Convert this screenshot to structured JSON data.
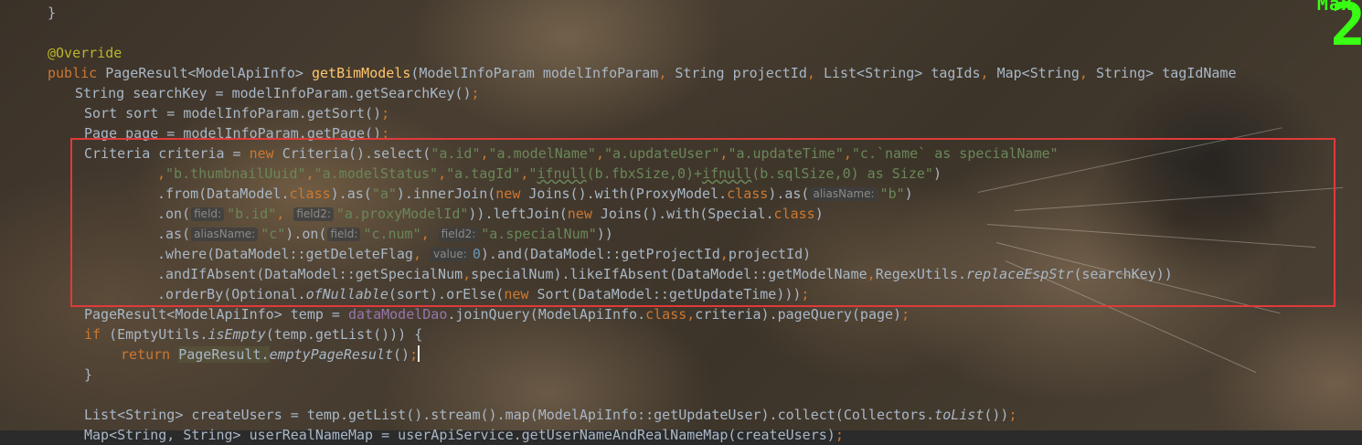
{
  "editor": {
    "theme_colors": {
      "keyword": "#cc7832",
      "annotation": "#bbb529",
      "method_declaration": "#ffc66d",
      "string": "#6a8759",
      "number": "#6897bb",
      "field": "#9876aa",
      "text": "#a9b7c6",
      "hint": "#8a8a8a",
      "highlight_box": "#e03a3a"
    },
    "lines": [
      {
        "indent": 52,
        "tokens": [
          {
            "t": "}",
            "c": "text"
          }
        ]
      },
      {
        "indent": 52,
        "tokens": []
      },
      {
        "indent": 52,
        "tokens": [
          {
            "t": "@Override",
            "c": "ann"
          }
        ]
      },
      {
        "indent": 52,
        "tokens": [
          {
            "t": "public ",
            "c": "kw"
          },
          {
            "t": "PageResult<ModelApiInfo> ",
            "c": "text"
          },
          {
            "t": "getBimModels",
            "c": "fn"
          },
          {
            "t": "(ModelInfoParam modelInfoParam",
            "c": "text"
          },
          {
            "t": ", ",
            "c": "kw"
          },
          {
            "t": "String projectId",
            "c": "text"
          },
          {
            "t": ", ",
            "c": "kw"
          },
          {
            "t": "List<String> tagIds",
            "c": "text"
          },
          {
            "t": ", ",
            "c": "kw"
          },
          {
            "t": "Map<String",
            "c": "text"
          },
          {
            "t": ", ",
            "c": "kw"
          },
          {
            "t": "String> tagIdName",
            "c": "text"
          }
        ]
      },
      {
        "indent": 82,
        "tokens": [
          {
            "t": "String searchKey = modelInfoParam.getSearchKey()",
            "c": "text"
          },
          {
            "t": ";",
            "c": "kw"
          }
        ]
      },
      {
        "indent": 92,
        "tokens": [
          {
            "t": "Sort sort = modelInfoParam.getSort()",
            "c": "text"
          },
          {
            "t": ";",
            "c": "kw"
          }
        ]
      },
      {
        "indent": 92,
        "tokens": [
          {
            "t": "Page ",
            "c": "text"
          },
          {
            "t": "page",
            "c": "link"
          },
          {
            "t": " = modelInfoParam.getPage()",
            "c": "text"
          },
          {
            "t": ";",
            "c": "kw"
          }
        ]
      },
      {
        "indent": 92,
        "tokens": [
          {
            "t": "Criteria criteria = ",
            "c": "text"
          },
          {
            "t": "new ",
            "c": "kw"
          },
          {
            "t": "Criteria().select(",
            "c": "text"
          },
          {
            "t": "\"a.id\"",
            "c": "str"
          },
          {
            "t": ",",
            "c": "kw"
          },
          {
            "t": "\"a.modelName\"",
            "c": "str"
          },
          {
            "t": ",",
            "c": "kw"
          },
          {
            "t": "\"a.updateUser\"",
            "c": "str"
          },
          {
            "t": ",",
            "c": "kw"
          },
          {
            "t": "\"a.updateTime\"",
            "c": "str"
          },
          {
            "t": ",",
            "c": "kw"
          },
          {
            "t": "\"c.`name` as specialName\"",
            "c": "str"
          }
        ]
      },
      {
        "indent": 172,
        "tokens": [
          {
            "t": ",",
            "c": "kw"
          },
          {
            "t": "\"b.thumbnailUuid\"",
            "c": "str"
          },
          {
            "t": ",",
            "c": "kw"
          },
          {
            "t": "\"a.modelStatus\"",
            "c": "str"
          },
          {
            "t": ",",
            "c": "kw"
          },
          {
            "t": "\"a.tagId\"",
            "c": "str"
          },
          {
            "t": ",",
            "c": "kw"
          },
          {
            "t": "\"",
            "c": "str"
          },
          {
            "t": "ifnull",
            "c": "strunder"
          },
          {
            "t": "(b.fbxSize,0)+",
            "c": "str"
          },
          {
            "t": "ifnull",
            "c": "strunder"
          },
          {
            "t": "(b.sqlSize,0) as Size\"",
            "c": "str"
          },
          {
            "t": ")",
            "c": "text"
          }
        ]
      },
      {
        "indent": 172,
        "tokens": [
          {
            "t": ".from(DataModel.",
            "c": "text"
          },
          {
            "t": "class",
            "c": "kw"
          },
          {
            "t": ").as(",
            "c": "text"
          },
          {
            "t": "\"a\"",
            "c": "str"
          },
          {
            "t": ").innerJoin(",
            "c": "text"
          },
          {
            "t": "new ",
            "c": "kw"
          },
          {
            "t": "Joins().with(ProxyModel.",
            "c": "text"
          },
          {
            "t": "class",
            "c": "kw"
          },
          {
            "t": ").as(",
            "c": "text"
          },
          {
            "t": "aliasName:",
            "c": "hint"
          },
          {
            "t": "\"b\"",
            "c": "str"
          },
          {
            "t": ")",
            "c": "text"
          }
        ]
      },
      {
        "indent": 172,
        "tokens": [
          {
            "t": ".on(",
            "c": "text"
          },
          {
            "t": "field:",
            "c": "hint"
          },
          {
            "t": "\"b.id\"",
            "c": "str"
          },
          {
            "t": ", ",
            "c": "kw"
          },
          {
            "t": "field2:",
            "c": "hint"
          },
          {
            "t": "\"a.proxyModelId\"",
            "c": "str"
          },
          {
            "t": ")).leftJoin(",
            "c": "text"
          },
          {
            "t": "new ",
            "c": "kw"
          },
          {
            "t": "Joins().with(Special.",
            "c": "text"
          },
          {
            "t": "class",
            "c": "kw"
          },
          {
            "t": ")",
            "c": "text"
          }
        ]
      },
      {
        "indent": 172,
        "tokens": [
          {
            "t": ".as(",
            "c": "text"
          },
          {
            "t": "aliasName:",
            "c": "hint"
          },
          {
            "t": "\"c\"",
            "c": "str"
          },
          {
            "t": ").on(",
            "c": "text"
          },
          {
            "t": "field:",
            "c": "hint"
          },
          {
            "t": "\"c.num\"",
            "c": "str"
          },
          {
            "t": ", ",
            "c": "kw"
          },
          {
            "t": "field2:",
            "c": "hint"
          },
          {
            "t": "\"a.specialNum\"",
            "c": "str"
          },
          {
            "t": "))",
            "c": "text"
          }
        ]
      },
      {
        "indent": 172,
        "tokens": [
          {
            "t": ".where(DataModel::getDeleteFlag",
            "c": "text"
          },
          {
            "t": ", ",
            "c": "kw"
          },
          {
            "t": "value:",
            "c": "hint"
          },
          {
            "t": "0",
            "c": "num"
          },
          {
            "t": ").and(DataModel::getProjectId",
            "c": "text"
          },
          {
            "t": ",",
            "c": "kw"
          },
          {
            "t": "projectId)",
            "c": "text"
          }
        ]
      },
      {
        "indent": 172,
        "tokens": [
          {
            "t": ".andIfAbsent(DataModel::getSpecialNum",
            "c": "text"
          },
          {
            "t": ",",
            "c": "kw"
          },
          {
            "t": "specialNum).likeIfAbsent(DataModel::getModelName",
            "c": "text"
          },
          {
            "t": ",",
            "c": "kw"
          },
          {
            "t": "RegexUtils.",
            "c": "text"
          },
          {
            "t": "replaceEspStr",
            "c": "italic"
          },
          {
            "t": "(searchKey))",
            "c": "text"
          }
        ]
      },
      {
        "indent": 172,
        "tokens": [
          {
            "t": ".orderBy(Optional.",
            "c": "text"
          },
          {
            "t": "ofNullable",
            "c": "italic"
          },
          {
            "t": "(sort).orElse(",
            "c": "text"
          },
          {
            "t": "new ",
            "c": "kw"
          },
          {
            "t": "Sort(DataModel::getUpdateTime)))",
            "c": "text"
          },
          {
            "t": ";",
            "c": "kw"
          }
        ]
      },
      {
        "indent": 92,
        "tokens": [
          {
            "t": "PageResult<ModelApiInfo> temp = ",
            "c": "text"
          },
          {
            "t": "dataModelDao",
            "c": "field"
          },
          {
            "t": ".joinQuery(ModelApiInfo.",
            "c": "text"
          },
          {
            "t": "class",
            "c": "kw"
          },
          {
            "t": ",",
            "c": "kw"
          },
          {
            "t": "criteria).pageQuery(page)",
            "c": "text"
          },
          {
            "t": ";",
            "c": "kw"
          }
        ]
      },
      {
        "indent": 92,
        "tokens": [
          {
            "t": "if ",
            "c": "kw"
          },
          {
            "t": "(EmptyUtils.",
            "c": "text"
          },
          {
            "t": "isEmpty",
            "c": "italic"
          },
          {
            "t": "(temp.getList())) {",
            "c": "text"
          }
        ]
      },
      {
        "indent": 132,
        "tokens": [
          {
            "t": "return ",
            "c": "kw"
          },
          {
            "t": "PageResult.",
            "c": "cursorword"
          },
          {
            "t": "emptyPageResult",
            "c": "italic"
          },
          {
            "t": "()",
            "c": "text"
          },
          {
            "t": ";",
            "c": "kw"
          },
          {
            "t": "",
            "c": "caret"
          }
        ]
      },
      {
        "indent": 92,
        "tokens": [
          {
            "t": "}",
            "c": "text"
          }
        ]
      },
      {
        "indent": 92,
        "tokens": []
      },
      {
        "indent": 92,
        "tokens": [
          {
            "t": "List<String> createUsers = temp.getList().stream().map(ModelApiInfo::getUpdateUser).collect(Collectors.",
            "c": "text"
          },
          {
            "t": "toList",
            "c": "italic"
          },
          {
            "t": "())",
            "c": "text"
          },
          {
            "t": ";",
            "c": "kw"
          }
        ]
      },
      {
        "indent": 92,
        "tokens": [
          {
            "t": "Map<String, String> userRealNameMap = userApiService.getUserNameAndRealNameMap(createUsers)",
            "c": "text"
          },
          {
            "t": ";",
            "c": "kw"
          }
        ]
      }
    ]
  },
  "overlay": {
    "label": "Max",
    "big_value": "2"
  }
}
